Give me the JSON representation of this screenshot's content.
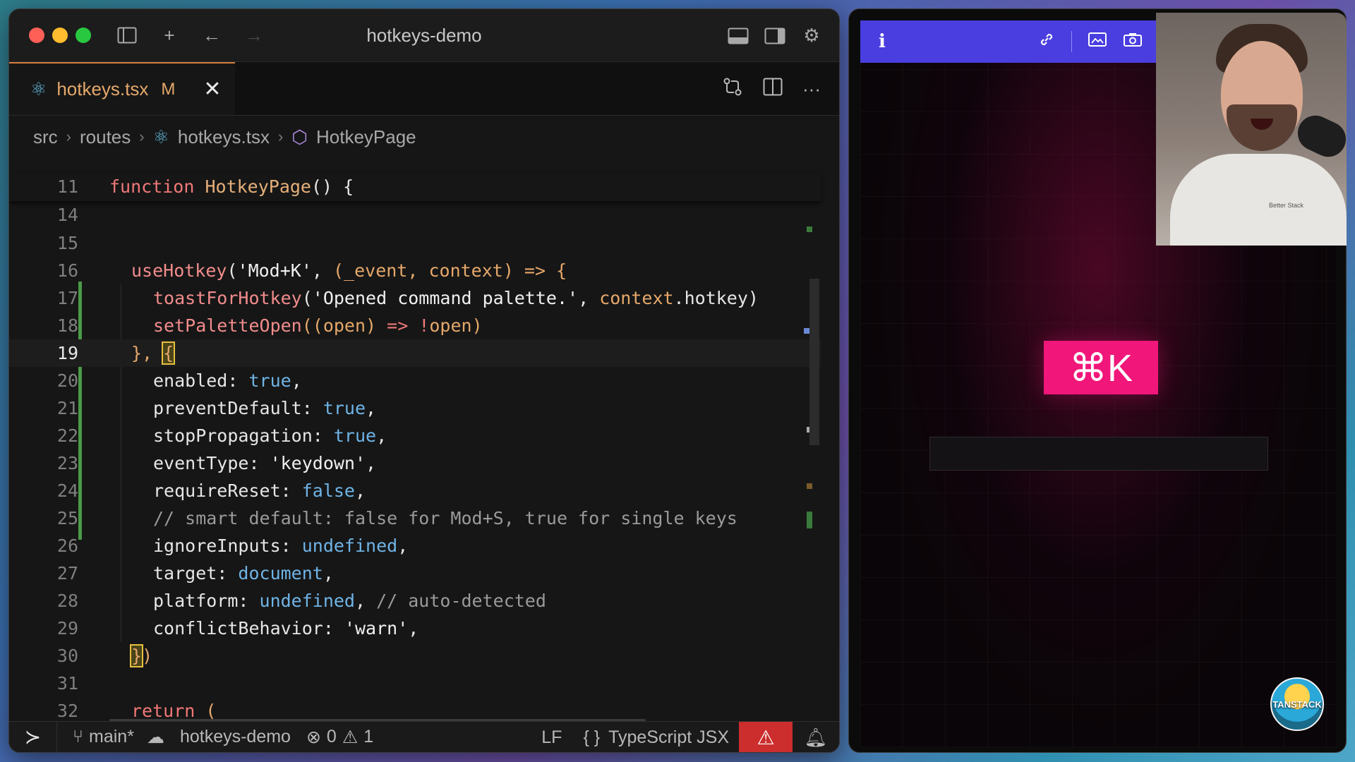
{
  "editor": {
    "window_title": "hotkeys-demo",
    "tab": {
      "filename": "hotkeys.tsx",
      "status": "M"
    },
    "breadcrumb": [
      "src",
      "routes",
      "hotkeys.tsx",
      "HotkeyPage"
    ],
    "sticky_line": {
      "num": "11",
      "code": "function HotkeyPage() {"
    },
    "lines": [
      {
        "num": "14"
      },
      {
        "num": "15"
      },
      {
        "num": "16"
      },
      {
        "num": "17"
      },
      {
        "num": "18"
      },
      {
        "num": "19"
      },
      {
        "num": "20"
      },
      {
        "num": "21"
      },
      {
        "num": "22"
      },
      {
        "num": "23"
      },
      {
        "num": "24"
      },
      {
        "num": "25"
      },
      {
        "num": "26"
      },
      {
        "num": "27"
      },
      {
        "num": "28"
      },
      {
        "num": "29"
      },
      {
        "num": "30"
      },
      {
        "num": "31"
      },
      {
        "num": "32"
      }
    ],
    "code": {
      "l16": {
        "fn": "useHotkey",
        "open": "(",
        "str": "'Mod+K'",
        "comma": ", ",
        "params": "(_event, context)",
        "arrow": " => {"
      },
      "l17": {
        "fn": "toastForHotkey",
        "open": "(",
        "str": "'Opened command palette.'",
        "comma": ", ",
        "obj": "context",
        "prop": ".hotkey)"
      },
      "l18": {
        "fn": "setPaletteOpen",
        "open": "((",
        "p": "open",
        "close1": ") ",
        "arrow": "=> ",
        "neg": "!",
        "p2": "open",
        "close2": ")"
      },
      "l19": {
        "close": "}, ",
        "brace": "{"
      },
      "l20": {
        "key": "enabled: ",
        "val": "true",
        "end": ","
      },
      "l21": {
        "key": "preventDefault: ",
        "val": "true",
        "end": ","
      },
      "l22": {
        "key": "stopPropagation: ",
        "val": "true",
        "end": ","
      },
      "l23": {
        "key": "eventType: ",
        "val": "'keydown'",
        "end": ","
      },
      "l24": {
        "key": "requireReset: ",
        "val": "false",
        "end": ","
      },
      "l25": {
        "comment": "// smart default: false for Mod+S, true for single keys"
      },
      "l26": {
        "key": "ignoreInputs: ",
        "val": "undefined",
        "end": ","
      },
      "l27": {
        "key": "target: ",
        "val": "document",
        "end": ","
      },
      "l28": {
        "key": "platform: ",
        "val": "undefined",
        "end": ", ",
        "comment": "// auto-detected"
      },
      "l29": {
        "key": "conflictBehavior: ",
        "val": "'warn'",
        "end": ","
      },
      "l30": {
        "brace": "}",
        "close": ")"
      },
      "l32": {
        "kw": "return",
        "rest": " ("
      }
    },
    "status": {
      "branch": "main*",
      "project": "hotkeys-demo",
      "errors": "0",
      "warnings": "1",
      "eol": "LF",
      "language": "TypeScript JSX"
    }
  },
  "browser": {
    "info_label": "i",
    "hotkey_display": "⌘K",
    "webcam_logo": "Better Stack",
    "watermark": "TANSTACK"
  }
}
